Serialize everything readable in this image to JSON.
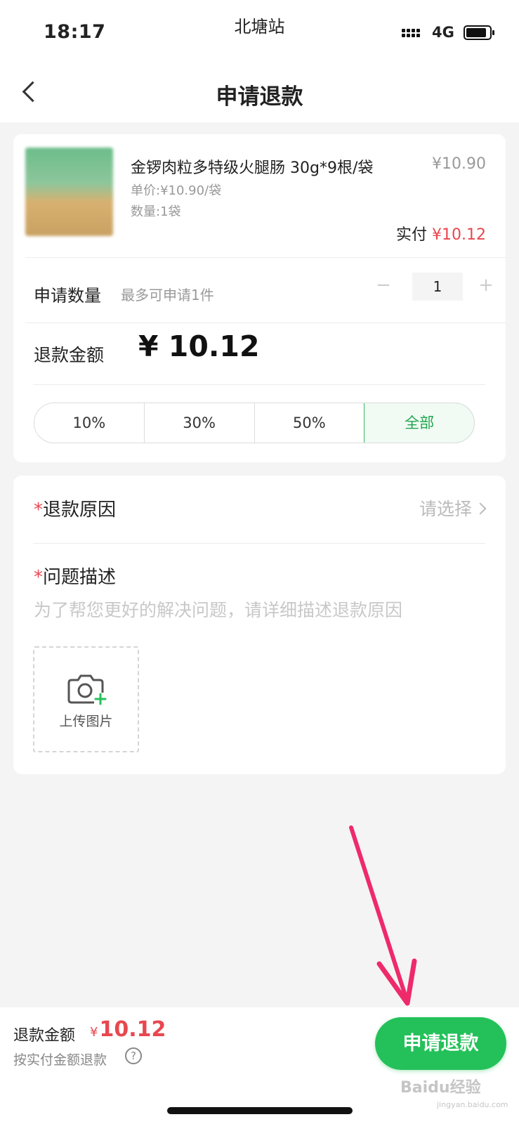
{
  "status_bar": {
    "time": "18:17",
    "carrier": "北塘站",
    "network": "4G"
  },
  "nav": {
    "title": "申请退款"
  },
  "product": {
    "name": "金锣肉粒多特级火腿肠 30g*9根/袋",
    "price": "¥10.90",
    "unit_price": "单价:¥10.90/袋",
    "quantity": "数量:1袋",
    "paid_label": "实付",
    "paid_value": "¥10.12"
  },
  "apply_quantity": {
    "label": "申请数量",
    "hint": "最多可申请1件",
    "minus": "−",
    "value": "1",
    "plus": "+"
  },
  "refund_amount": {
    "label": "退款金额",
    "value": "¥ 10.12"
  },
  "percent_options": [
    "10%",
    "30%",
    "50%",
    "全部"
  ],
  "selected_option": "全部",
  "reason": {
    "required_mark": "*",
    "label": "退款原因",
    "placeholder": "请选择"
  },
  "description": {
    "required_mark": "*",
    "label": "问题描述",
    "placeholder": "为了帮您更好的解决问题，请详细描述退款原因"
  },
  "upload": {
    "label": "上传图片",
    "icon": "camera-plus-icon"
  },
  "bottom_bar": {
    "label": "退款金额",
    "currency": "¥",
    "amount": "10.12",
    "note": "按实付金额退款",
    "help": "?",
    "submit": "申请退款"
  },
  "watermark": {
    "brand": "Baidu经验",
    "url": "jingyan.baidu.com"
  },
  "colors": {
    "accent_green": "#24c15a",
    "price_red": "#e8474f",
    "annotation_arrow": "#ee2a6b"
  }
}
